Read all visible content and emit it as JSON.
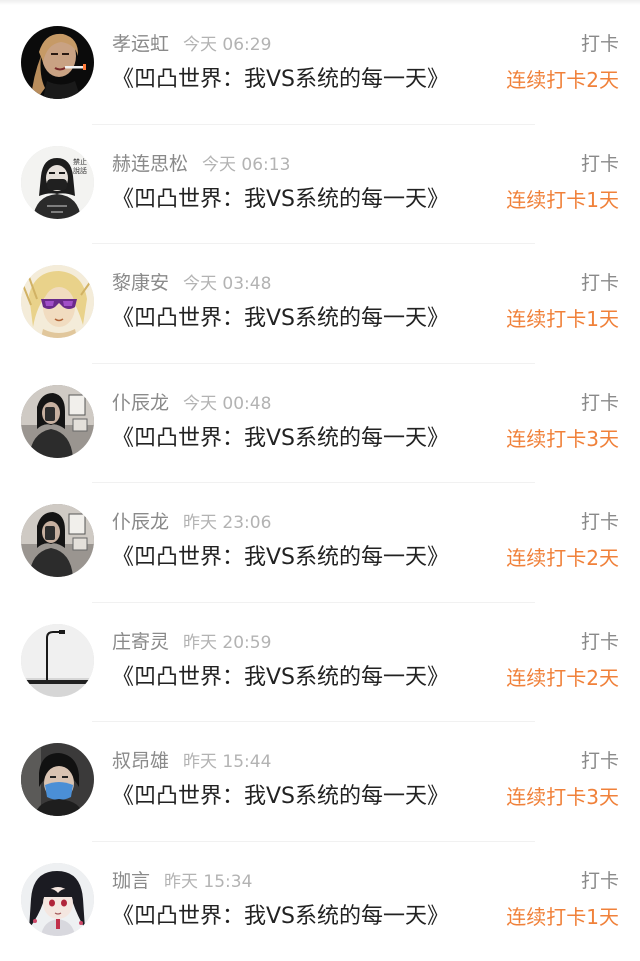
{
  "colors": {
    "accent": "#f0813a",
    "name_text": "#8a8a8a",
    "time_text": "#b3b3b3",
    "title_text": "#222222"
  },
  "checkins": [
    {
      "user": "孝运虹",
      "time": "今天 06:29",
      "book": "《凹凸世界：我VS系统的每一天》",
      "type": "打卡",
      "streak": "连续打卡2天",
      "avatar": "avatar-woman-smoking"
    },
    {
      "user": "赫连思松",
      "time": "今天 06:13",
      "book": "《凹凸世界：我VS系统的每一天》",
      "type": "打卡",
      "streak": "连续打卡1天",
      "avatar": "avatar-masked-figure"
    },
    {
      "user": "黎康安",
      "time": "今天 03:48",
      "book": "《凹凸世界：我VS系统的每一天》",
      "type": "打卡",
      "streak": "连续打卡1天",
      "avatar": "avatar-anime-sunglasses"
    },
    {
      "user": "仆辰龙",
      "time": "今天 00:48",
      "book": "《凹凸世界：我VS系统的每一天》",
      "type": "打卡",
      "streak": "连续打卡3天",
      "avatar": "avatar-selfie-room"
    },
    {
      "user": "仆辰龙",
      "time": "昨天 23:06",
      "book": "《凹凸世界：我VS系统的每一天》",
      "type": "打卡",
      "streak": "连续打卡2天",
      "avatar": "avatar-selfie-room"
    },
    {
      "user": "庄寄灵",
      "time": "昨天 20:59",
      "book": "《凹凸世界：我VS系统的每一天》",
      "type": "打卡",
      "streak": "连续打卡2天",
      "avatar": "avatar-streetlamp"
    },
    {
      "user": "叔昂雄",
      "time": "昨天 15:44",
      "book": "《凹凸世界：我VS系统的每一天》",
      "type": "打卡",
      "streak": "连续打卡3天",
      "avatar": "avatar-face-mask"
    },
    {
      "user": "珈言",
      "time": "昨天 15:34",
      "book": "《凹凸世界：我VS系统的每一天》",
      "type": "打卡",
      "streak": "连续打卡1天",
      "avatar": "avatar-anime-girl"
    }
  ]
}
